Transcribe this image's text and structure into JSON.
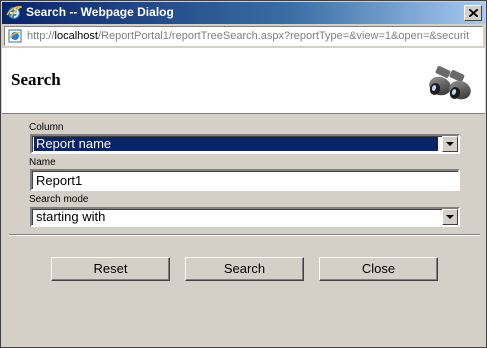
{
  "window": {
    "title": "Search -- Webpage Dialog",
    "address": {
      "prefix": "http://",
      "host": "localhost",
      "path": "/ReportPortal1/reportTreeSearch.aspx?reportType=&view=1&open=&securit"
    }
  },
  "header": {
    "title": "Search",
    "icon": "binoculars-icon"
  },
  "form": {
    "column": {
      "label": "Column",
      "value": "Report name"
    },
    "name": {
      "label": "Name",
      "value": "Report1"
    },
    "search_mode": {
      "label": "Search mode",
      "value": "starting with"
    }
  },
  "buttons": {
    "reset": "Reset",
    "search": "Search",
    "close": "Close"
  },
  "colors": {
    "titlebar_start": "#0a246a",
    "dialog_bg": "#d4d0c8",
    "selection": "#0a246a"
  }
}
